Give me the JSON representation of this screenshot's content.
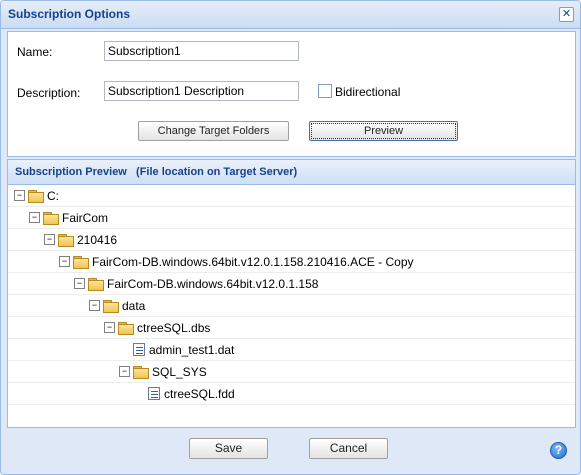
{
  "window": {
    "title": "Subscription Options",
    "close_glyph": "✕"
  },
  "form": {
    "name_label": "Name:",
    "name_value": "Subscription1",
    "description_label": "Description:",
    "description_value": "Subscription1 Description",
    "bidirectional_label": "Bidirectional",
    "bidirectional_checked": false,
    "change_target_label": "Change Target Folders",
    "preview_label": "Preview"
  },
  "preview_panel": {
    "title": "Subscription Preview",
    "subtitle": "(File location on Target Server)",
    "tree": [
      {
        "label": "C:",
        "type": "folder",
        "depth": 0,
        "expanded": true
      },
      {
        "label": "FairCom",
        "type": "folder",
        "depth": 1,
        "expanded": true
      },
      {
        "label": "210416",
        "type": "folder",
        "depth": 2,
        "expanded": true
      },
      {
        "label": "FairCom-DB.windows.64bit.v12.0.1.158.210416.ACE - Copy",
        "type": "folder",
        "depth": 3,
        "expanded": true
      },
      {
        "label": "FairCom-DB.windows.64bit.v12.0.1.158",
        "type": "folder",
        "depth": 4,
        "expanded": true
      },
      {
        "label": "data",
        "type": "folder",
        "depth": 5,
        "expanded": true
      },
      {
        "label": "ctreeSQL.dbs",
        "type": "folder",
        "depth": 6,
        "expanded": true
      },
      {
        "label": "admin_test1.dat",
        "type": "file",
        "depth": 7,
        "expanded": false
      },
      {
        "label": "SQL_SYS",
        "type": "folder",
        "depth": 7,
        "expanded": true
      },
      {
        "label": "ctreeSQL.fdd",
        "type": "file",
        "depth": 8,
        "expanded": false
      }
    ]
  },
  "footer": {
    "save_label": "Save",
    "cancel_label": "Cancel",
    "help_glyph": "?"
  },
  "icons": {
    "expanded_toggle": "−",
    "folder": "folder-icon",
    "file": "file-icon"
  },
  "colors": {
    "title_text": "#15428b",
    "window_bg": "#dfe8f6",
    "border": "#99bbe8"
  }
}
